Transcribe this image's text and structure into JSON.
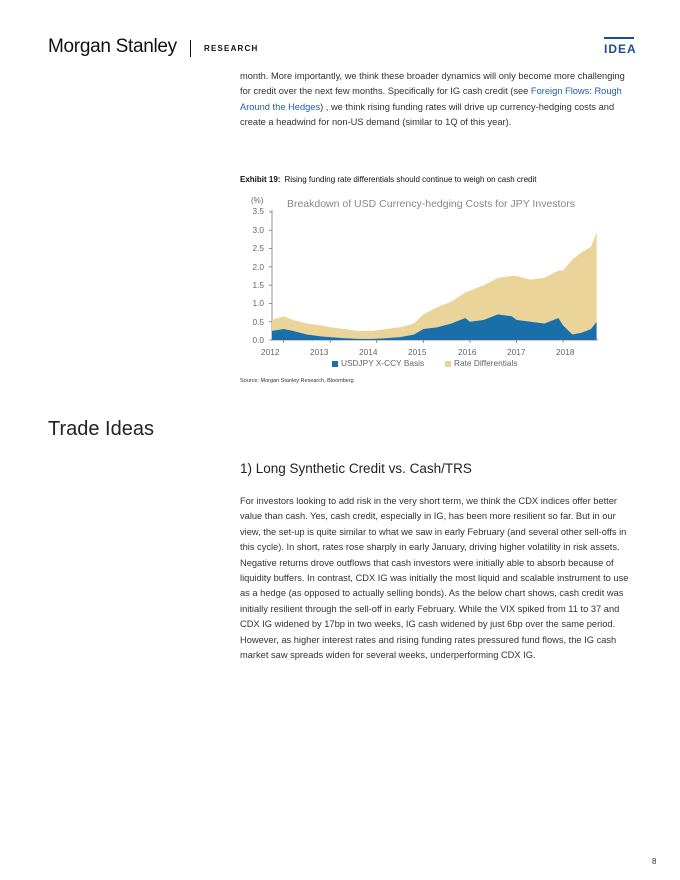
{
  "header": {
    "logo": "Morgan Stanley",
    "section": "RESEARCH",
    "badge": "IDEA"
  },
  "intro": {
    "text_before": "month. More importantly, we think these broader dynamics will only become more challenging for credit over the next few months. Specifically for IG cash credit (see ",
    "link": "Foreign Flows: Rough Around the Hedges",
    "text_after": ") , we think rising funding rates will drive up currency-hedging costs and create a headwind for non-US demand (similar to 1Q of this year)."
  },
  "exhibit": {
    "label": "Exhibit 19:",
    "caption": "Rising funding rate differentials should continue to weigh on cash credit"
  },
  "chart_data": {
    "type": "area",
    "title": "Breakdown of USD Currency-hedging Costs for JPY Investors",
    "unit": "(%)",
    "ylim": [
      0,
      3.5
    ],
    "yticks": [
      "0.0",
      "0.5",
      "1.0",
      "1.5",
      "2.0",
      "2.5",
      "3.0",
      "3.5"
    ],
    "xticks": [
      "2012",
      "2013",
      "2014",
      "2015",
      "2016",
      "2017",
      "2018"
    ],
    "x": [
      2011.75,
      2012.0,
      2012.2,
      2012.5,
      2012.8,
      2013.0,
      2013.3,
      2013.6,
      2013.9,
      2014.2,
      2014.5,
      2014.8,
      2015.0,
      2015.3,
      2015.6,
      2015.9,
      2016.0,
      2016.3,
      2016.6,
      2016.9,
      2017.0,
      2017.3,
      2017.6,
      2017.9,
      2018.0,
      2018.2,
      2018.4,
      2018.6,
      2018.72
    ],
    "series": [
      {
        "name": "USDJPY X-CCY Basis",
        "color": "#1a6fa8",
        "values": [
          0.25,
          0.3,
          0.25,
          0.15,
          0.1,
          0.08,
          0.05,
          0.03,
          0.03,
          0.05,
          0.08,
          0.15,
          0.3,
          0.35,
          0.45,
          0.6,
          0.5,
          0.55,
          0.7,
          0.65,
          0.55,
          0.5,
          0.45,
          0.6,
          0.4,
          0.15,
          0.2,
          0.3,
          0.5
        ]
      },
      {
        "name": "Rate Differentials",
        "color": "#ead49a",
        "values": [
          0.3,
          0.35,
          0.3,
          0.3,
          0.3,
          0.27,
          0.25,
          0.22,
          0.22,
          0.25,
          0.27,
          0.3,
          0.4,
          0.55,
          0.6,
          0.7,
          0.85,
          0.95,
          1.0,
          1.1,
          1.2,
          1.15,
          1.25,
          1.3,
          1.5,
          2.05,
          2.2,
          2.25,
          2.45
        ]
      }
    ]
  },
  "source": "Source: Morgan Stanley Research, Bloomberg",
  "trade_ideas": "Trade Ideas",
  "subheading": "1) Long Synthetic Credit vs. Cash/TRS",
  "body": "For investors looking to add risk in the very short term, we think the CDX indices offer better value than cash. Yes, cash credit, especially in IG, has been more resilient so far. But in our view, the set-up is quite similar to what we saw in early February (and several other sell-offs in this cycle). In short, rates rose sharply in early January, driving higher volatility in risk assets. Negative returns drove outflows that cash investors were initially able to absorb because of liquidity buffers. In contrast, CDX IG was initially the most liquid and scalable instrument to use as a hedge (as opposed to actually selling bonds). As the below chart shows, cash credit was initially resilient through the sell-off in early February. While the VIX spiked from 11 to 37 and CDX IG widened by 17bp in two weeks, IG cash widened by just 6bp over the same period. However, as higher interest rates and rising funding rates pressured fund flows, the IG cash market saw spreads widen for several weeks, underperforming CDX IG.",
  "page_number": "8"
}
